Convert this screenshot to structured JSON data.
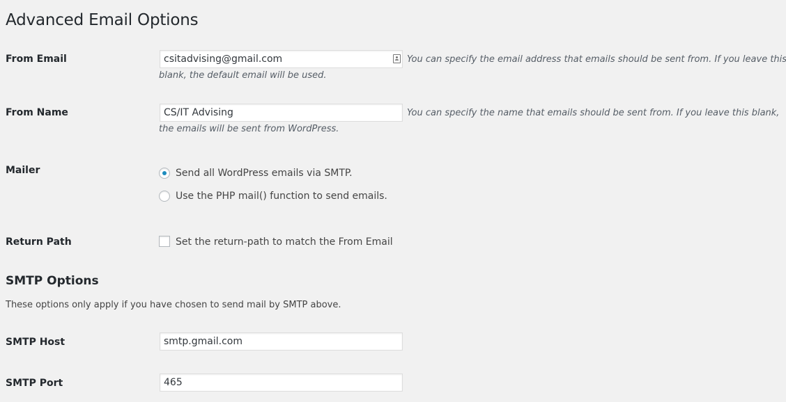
{
  "page": {
    "title": "Advanced Email Options"
  },
  "from_email": {
    "label": "From Email",
    "value": "csitadvising@gmail.com",
    "description": "You can specify the email address that emails should be sent from. If you leave this blank, the default email will be used."
  },
  "from_name": {
    "label": "From Name",
    "value": "CS/IT Advising",
    "description": "You can specify the name that emails should be sent from. If you leave this blank, the emails will be sent from WordPress."
  },
  "mailer": {
    "label": "Mailer",
    "options": [
      {
        "label": "Send all WordPress emails via SMTP.",
        "checked": true
      },
      {
        "label": "Use the PHP mail() function to send emails.",
        "checked": false
      }
    ]
  },
  "return_path": {
    "label": "Return Path",
    "checkbox_label": "Set the return-path to match the From Email",
    "checked": false
  },
  "smtp_section": {
    "title": "SMTP Options",
    "description": "These options only apply if you have chosen to send mail by SMTP above."
  },
  "smtp_host": {
    "label": "SMTP Host",
    "value": "smtp.gmail.com"
  },
  "smtp_port": {
    "label": "SMTP Port",
    "value": "465"
  },
  "colors": {
    "background": "#f1f1f1",
    "radio_accent": "#1e8cbe"
  }
}
